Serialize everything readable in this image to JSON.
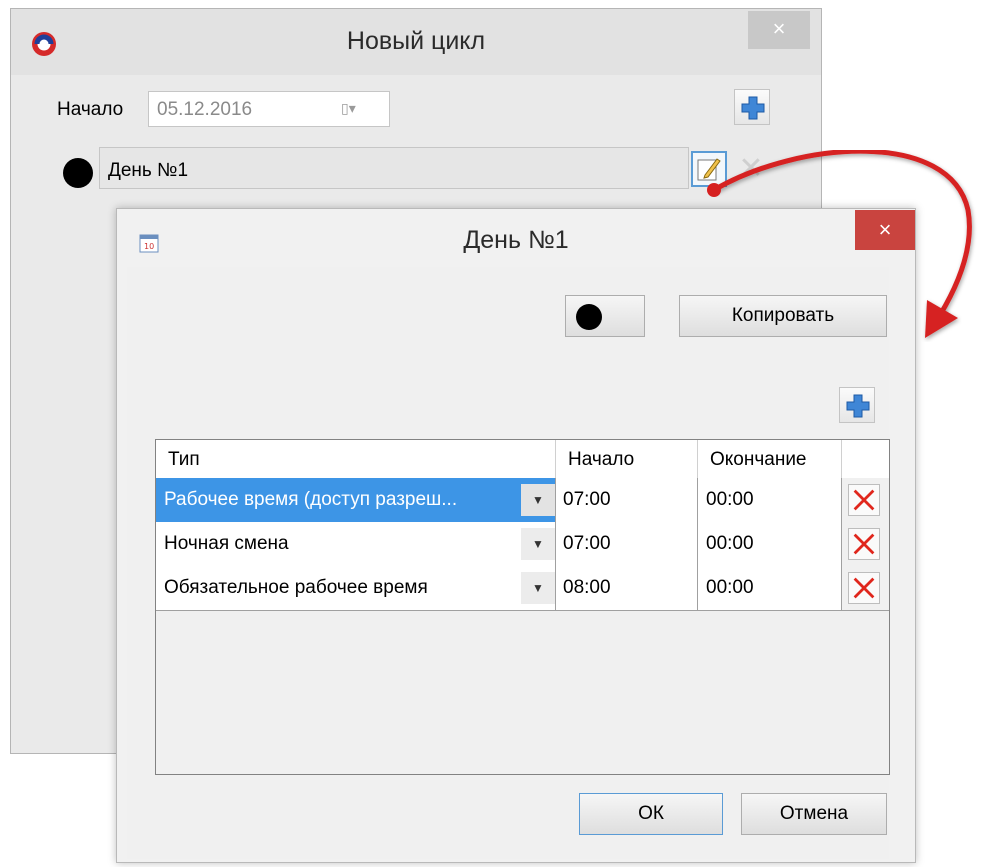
{
  "back_window": {
    "title": "Новый цикл",
    "close_glyph": "×",
    "start_label": "Начало",
    "start_date": "05.12.2016",
    "calendar_glyph": "▯▾",
    "day_name": "День №1",
    "delete_glyph": "✕"
  },
  "front_window": {
    "title": "День №1",
    "close_glyph": "×",
    "copy_button": "Копировать",
    "columns": [
      "Тип",
      "Начало",
      "Окончание"
    ],
    "rows": [
      {
        "type": "Рабочее время (доступ разреш...",
        "start": "07:00",
        "end": "00:00",
        "selected": true
      },
      {
        "type": "Ночная смена",
        "start": "07:00",
        "end": "00:00",
        "selected": false
      },
      {
        "type": "Обязательное рабочее время",
        "start": "08:00",
        "end": "00:00",
        "selected": false
      }
    ],
    "dropdown_glyph": "▼",
    "ok_button": "ОК",
    "cancel_button": "Отмена"
  },
  "colors": {
    "accent_selected": "#3d95e6",
    "close_red": "#c9443f",
    "arrow_red": "#d62020",
    "delete_red": "#e0261c",
    "plus_blue": "#3f86d6"
  },
  "icons": [
    "app-icon",
    "calendar-icon",
    "plus-icon",
    "edit-icon",
    "delete-icon",
    "color-dot-icon",
    "dropdown-arrow-icon"
  ]
}
